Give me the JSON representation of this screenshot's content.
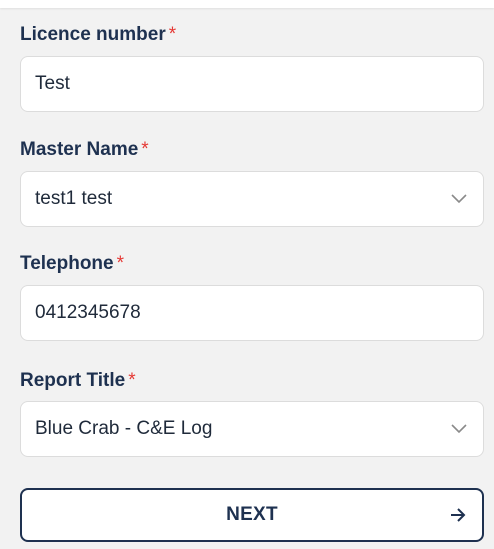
{
  "form": {
    "licence": {
      "label": "Licence number",
      "required_mark": "*",
      "value": "Test"
    },
    "master": {
      "label": "Master Name",
      "required_mark": "*",
      "value": "test1 test",
      "icon": "chevron-down-icon"
    },
    "telephone": {
      "label": "Telephone",
      "required_mark": "*",
      "value": "0412345678"
    },
    "report": {
      "label": "Report Title",
      "required_mark": "*",
      "value": "Blue Crab - C&E Log",
      "icon": "chevron-down-icon"
    }
  },
  "next_button": {
    "label": "NEXT",
    "icon": "arrow-right-icon"
  },
  "colors": {
    "background": "#f2f2f2",
    "label": "#1e3150",
    "required": "#e53935",
    "border": "#dcdcdc",
    "button_border": "#1e3150"
  }
}
